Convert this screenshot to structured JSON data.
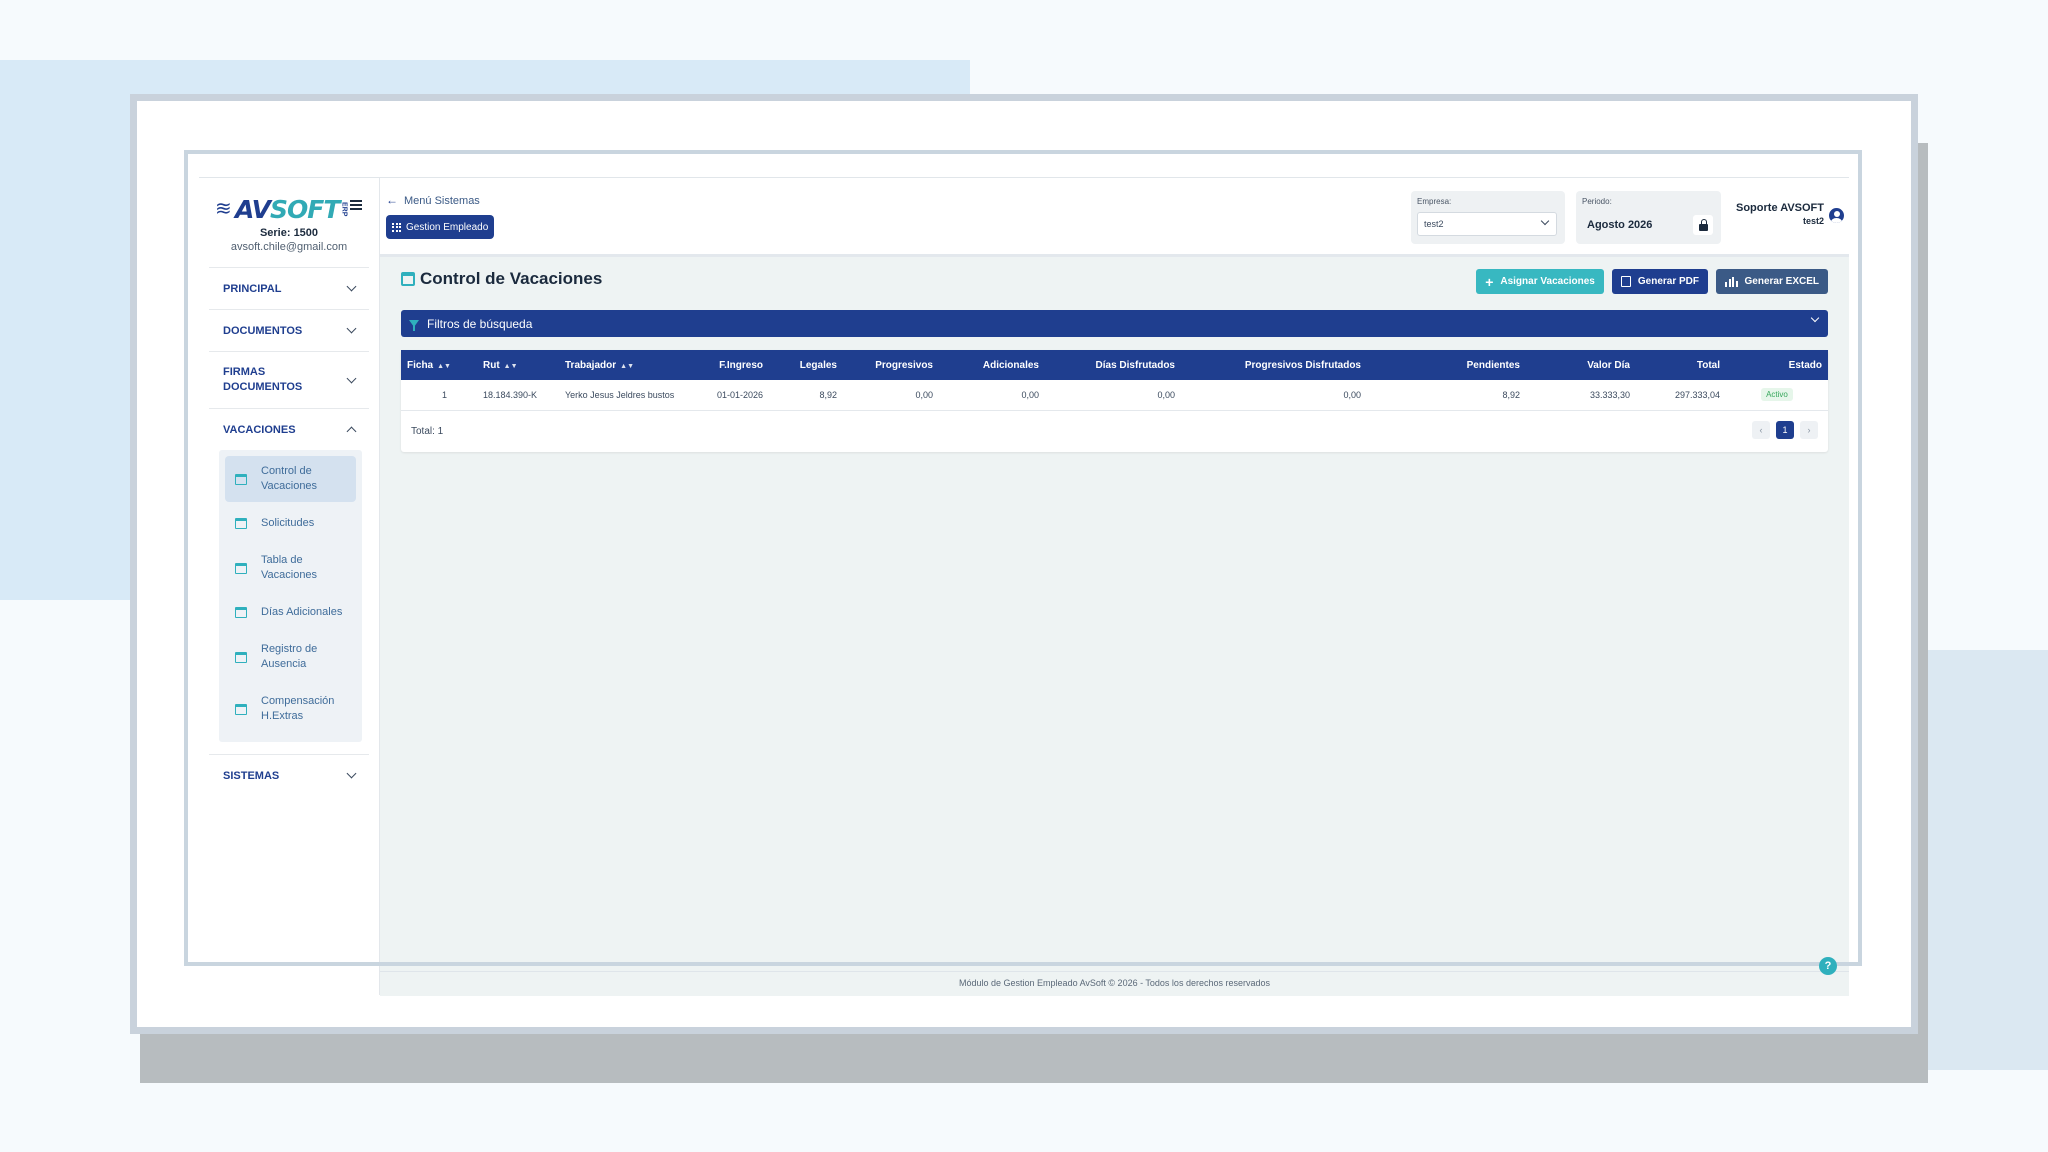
{
  "brand": {
    "logo_text_a": "AV",
    "logo_text_b": "SOFT",
    "logo_suffix": "ERP",
    "serie": "Serie: 1500",
    "email": "avsoft.chile@gmail.com"
  },
  "sidebar": {
    "sections": [
      {
        "label": "PRINCIPAL",
        "expanded": false
      },
      {
        "label": "DOCUMENTOS",
        "expanded": false
      },
      {
        "label": "FIRMAS DOCUMENTOS",
        "expanded": false
      },
      {
        "label": "VACACIONES",
        "expanded": true
      },
      {
        "label": "SISTEMAS",
        "expanded": false
      }
    ],
    "vacaciones_items": [
      {
        "label": "Control de Vacaciones",
        "active": true,
        "icon": "calendar-icon"
      },
      {
        "label": "Solicitudes",
        "active": false,
        "icon": "calendar-icon"
      },
      {
        "label": "Tabla de Vacaciones",
        "active": false,
        "icon": "calendar-icon"
      },
      {
        "label": "Días Adicionales",
        "active": false,
        "icon": "calendar-icon"
      },
      {
        "label": "Registro de Ausencia",
        "active": false,
        "icon": "document-icon"
      },
      {
        "label": "Compensación H.Extras",
        "active": false,
        "icon": "calendar-icon"
      }
    ]
  },
  "header": {
    "back_label": "Menú Sistemas",
    "module_button": "Gestion Empleado",
    "empresa_label": "Empresa:",
    "empresa_value": "test2",
    "periodo_label": "Periodo:",
    "periodo_value": "Agosto 2026",
    "user_name": "Soporte AVSOFT",
    "user_sub": "test2"
  },
  "main": {
    "title": "Control de Vacaciones",
    "buttons": {
      "assign": "Asignar Vacaciones",
      "pdf": "Generar PDF",
      "excel": "Generar EXCEL"
    },
    "filter_label": "Filtros de búsqueda",
    "table": {
      "columns": [
        "Ficha",
        "Rut",
        "Trabajador",
        "F.Ingreso",
        "Legales",
        "Progresivos",
        "Adicionales",
        "Días Disfrutados",
        "Progresivos Disfrutados",
        "Pendientes",
        "Valor Día",
        "Total",
        "Estado"
      ],
      "rows": [
        [
          "1",
          "18.184.390-K",
          "Yerko Jesus Jeldres bustos",
          "01-01-2026",
          "8,92",
          "0,00",
          "0,00",
          "0,00",
          "0,00",
          "8,92",
          "33.333,30",
          "297.333,04",
          "Activo"
        ]
      ],
      "total_label": "Total: 1",
      "pager": {
        "prev": "‹",
        "page": "1",
        "next": "›"
      }
    }
  },
  "footer": {
    "text": "Módulo de Gestion Empleado AvSoft © 2026 - Todos los derechos reservados"
  },
  "colors": {
    "navy": "#1f3e8f",
    "teal": "#38b8c1",
    "slate": "#3b5a86",
    "active_green": "#37a85c"
  }
}
